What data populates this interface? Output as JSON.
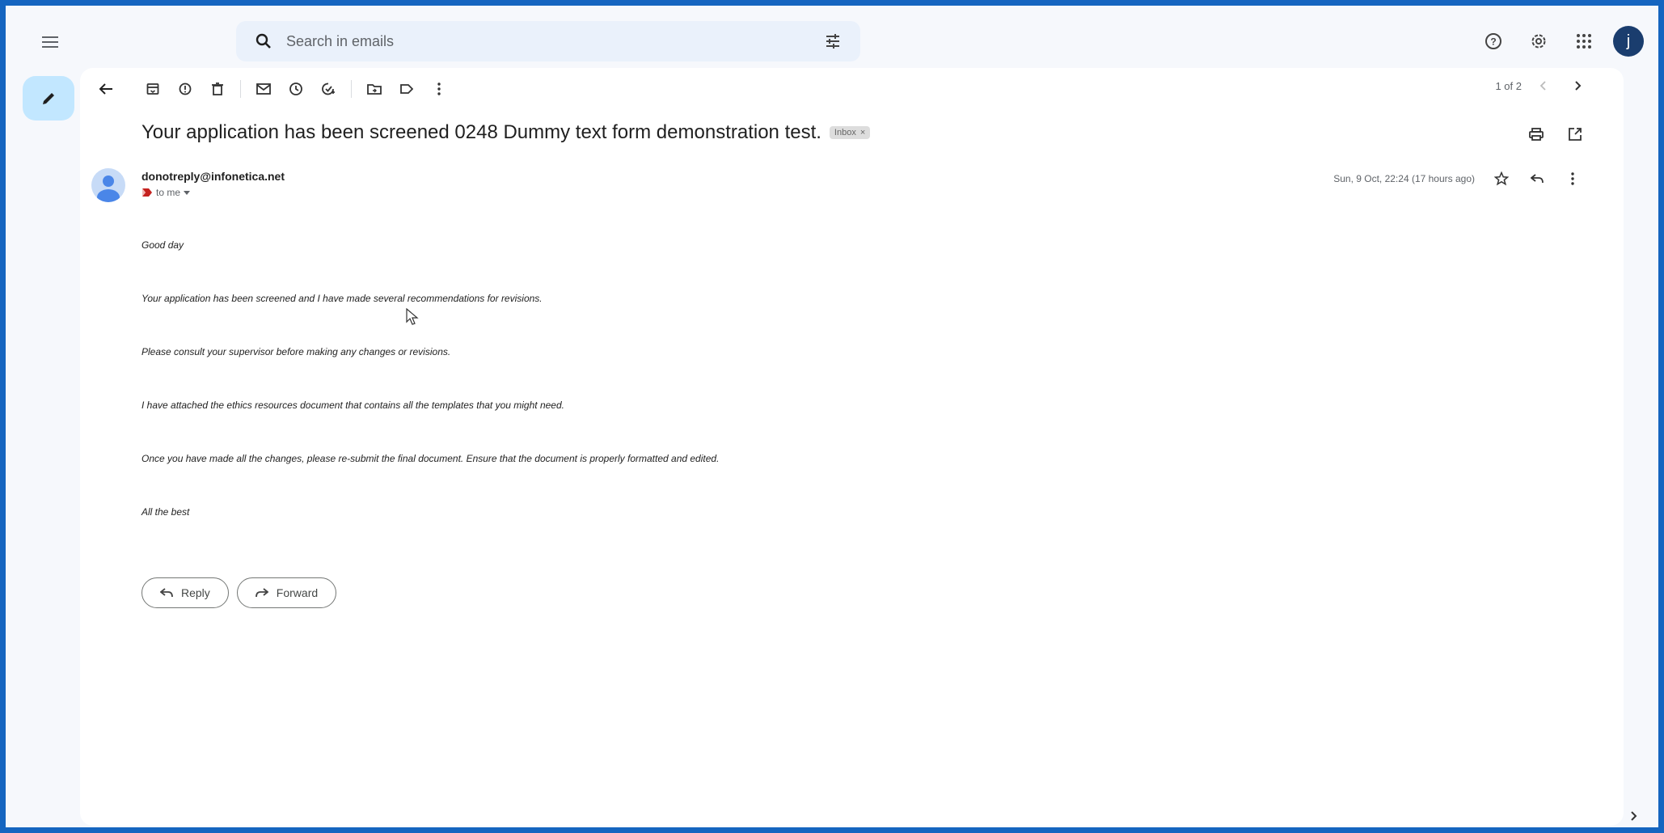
{
  "search": {
    "placeholder": "Search in emails"
  },
  "pager": {
    "text": "1 of 2"
  },
  "email": {
    "subject": "Your application has been screened 0248 Dummy text form demonstration test.",
    "label": "Inbox",
    "sender": "donotreply@infonetica.net",
    "to": "to me",
    "date": "Sun, 9 Oct, 22:24 (17 hours ago)",
    "body": [
      "Good day",
      "Your application has been screened and I have made several recommendations for revisions.",
      "Please consult your supervisor before making any changes or revisions.",
      "I have attached the ethics resources document that contains all the templates that you might need.",
      "Once you have made all the changes, please re-submit the final document. Ensure that the document is properly formatted and edited.",
      "All the best"
    ]
  },
  "actions": {
    "reply": "Reply",
    "forward": "Forward"
  },
  "account": {
    "initial": "j"
  },
  "colors": {
    "frame": "#1565c0",
    "search_bg": "#eaf1fb",
    "compose_bg": "#c2e7ff",
    "avatar": "#1a3d6e"
  }
}
